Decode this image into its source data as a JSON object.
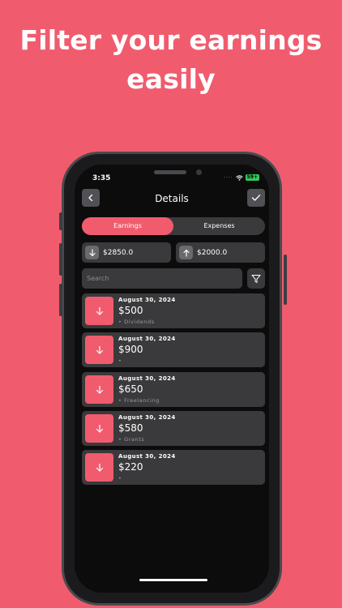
{
  "headline": {
    "line1": "Filter your earnings",
    "line2": "easily"
  },
  "status_bar": {
    "time": "3:35",
    "battery": "59+"
  },
  "nav": {
    "title": "Details",
    "back_icon": "chevron-left-icon",
    "confirm_icon": "checkmark-icon"
  },
  "tabs": [
    {
      "label": "Earnings",
      "active": true
    },
    {
      "label": "Expenses",
      "active": false
    }
  ],
  "totals": {
    "income": {
      "value": "$2850.0",
      "icon": "arrow-down-icon"
    },
    "expense": {
      "value": "$2000.0",
      "icon": "arrow-up-icon"
    }
  },
  "search": {
    "placeholder": "Search",
    "filter_icon": "filter-funnel-icon"
  },
  "transactions": [
    {
      "date": "August 30, 2024",
      "amount": "$500",
      "category": "Dividends"
    },
    {
      "date": "August 30, 2024",
      "amount": "$900",
      "category": ""
    },
    {
      "date": "August 30, 2024",
      "amount": "$650",
      "category": "Freelancing"
    },
    {
      "date": "August 30, 2024",
      "amount": "$580",
      "category": "Grants"
    },
    {
      "date": "August 30, 2024",
      "amount": "$220",
      "category": ""
    }
  ],
  "colors": {
    "accent": "#f05c6e",
    "card": "#3a3a3c",
    "screen": "#0c0c0c"
  }
}
